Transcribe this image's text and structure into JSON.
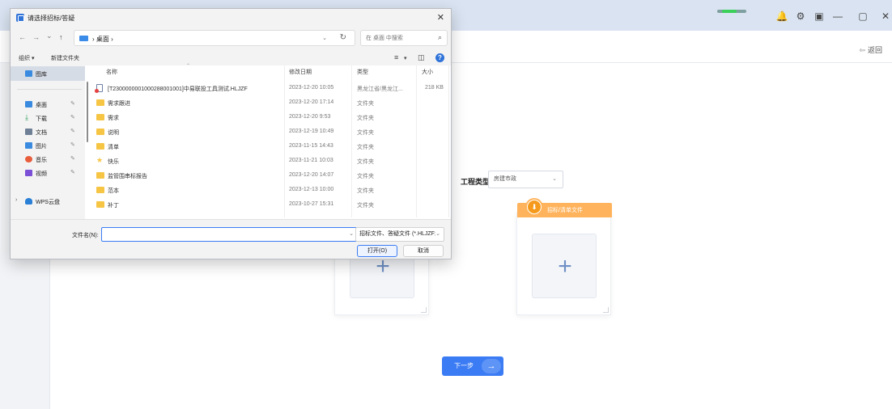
{
  "app": {
    "back_label": "返回",
    "project_type_label": "工程类型:",
    "project_type_value": "房建市政",
    "upload_card_title": "招标/清单文件",
    "plus_glyph": "+",
    "next_button": "下一步",
    "next_arrow": "→",
    "window_controls": [
      "🔔",
      "⚙",
      "▣",
      "—",
      "▢",
      "✕"
    ]
  },
  "dialog": {
    "title": "请选择招标/答疑",
    "close": "✕",
    "nav_buttons": [
      "←",
      "→",
      "⌄",
      "↑"
    ],
    "address_path": "› 桌面 ›",
    "address_dropdown": "⌄",
    "refresh": "↻",
    "search_placeholder": "在 桌面 中搜索",
    "search_icon": "⌕",
    "toolbar": {
      "organize": "组织 ▾",
      "new_folder": "新建文件夹",
      "view_icons": [
        "≡",
        "▾",
        "◫"
      ],
      "help": "?"
    },
    "sidebar": [
      {
        "label": "图库",
        "icon": "gallery-icon",
        "color": "#3a8be0",
        "pinned": false
      },
      {
        "label": "桌面",
        "icon": "desktop-icon",
        "color": "#3a8be0",
        "pinned": true
      },
      {
        "label": "下载",
        "icon": "download-icon",
        "color": "#2f9d5b",
        "pinned": true
      },
      {
        "label": "文档",
        "icon": "document-icon",
        "color": "#6f7f95",
        "pinned": true
      },
      {
        "label": "图片",
        "icon": "pictures-icon",
        "color": "#3a8be0",
        "pinned": true
      },
      {
        "label": "音乐",
        "icon": "music-icon",
        "color": "#e85d3c",
        "pinned": true
      },
      {
        "label": "视频",
        "icon": "video-icon",
        "color": "#7b4fd6",
        "pinned": true
      },
      {
        "label": "WPS云盘",
        "icon": "wps-cloud-icon",
        "color": "#2a7fd6",
        "pinned": false
      }
    ],
    "columns": [
      "名称",
      "修改日期",
      "类型",
      "大小"
    ],
    "sort_indicator": "⌃",
    "files": [
      {
        "name": "[T2300000001000288001001]中易联投工具测试.HLJZF",
        "date": "2023-12-20 10:05",
        "type": "黑龙江省/黑龙江...",
        "size": "218 KB",
        "icon": "doc"
      },
      {
        "name": "需求跟进",
        "date": "2023-12-20 17:14",
        "type": "文件夹",
        "size": "",
        "icon": "folder"
      },
      {
        "name": "需求",
        "date": "2023-12-20 9:53",
        "type": "文件夹",
        "size": "",
        "icon": "folder"
      },
      {
        "name": "说明",
        "date": "2023-12-19 10:49",
        "type": "文件夹",
        "size": "",
        "icon": "folder"
      },
      {
        "name": "清单",
        "date": "2023-11-15 14:43",
        "type": "文件夹",
        "size": "",
        "icon": "folder"
      },
      {
        "name": "快乐",
        "date": "2023-11-21 10:03",
        "type": "文件夹",
        "size": "",
        "icon": "star"
      },
      {
        "name": "监管围串标报告",
        "date": "2023-12-20 14:07",
        "type": "文件夹",
        "size": "",
        "icon": "folder"
      },
      {
        "name": "范本",
        "date": "2023-12-13 10:00",
        "type": "文件夹",
        "size": "",
        "icon": "folder"
      },
      {
        "name": "补丁",
        "date": "2023-10-27 15:31",
        "type": "文件夹",
        "size": "",
        "icon": "folder"
      }
    ],
    "filename_label": "文件名(N):",
    "filename_value": "",
    "filename_dropdown": "⌄",
    "filetype_value": "招标文件、答疑文件 (*.HLJZF;*",
    "filetype_dropdown": "⌄",
    "open_button": "打开(O)",
    "cancel_button": "取消"
  }
}
